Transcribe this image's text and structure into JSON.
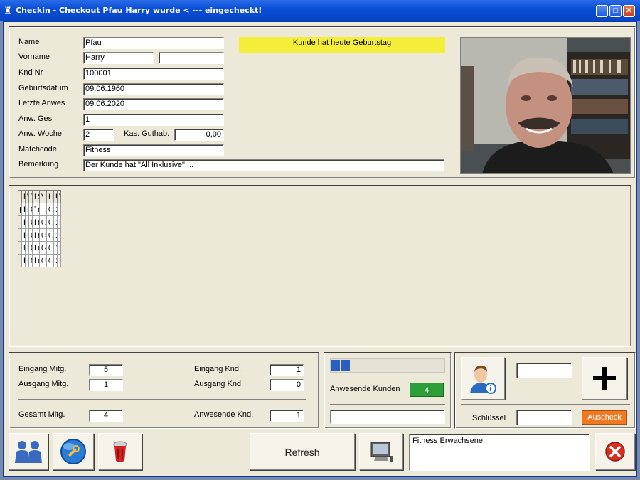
{
  "window": {
    "title": "Checkin - Checkout Pfau Harry wurde < --- eingecheckt!"
  },
  "form": {
    "labels": {
      "name": "Name",
      "vorname": "Vorname",
      "kndnr": "Knd Nr",
      "geburtsdatum": "Geburtsdatum",
      "letzte_anwes": "Letzte Anwes",
      "anw_ges": "Anw. Ges",
      "anw_woche": "Anw. Woche",
      "kas_guthab": "Kas. Guthab.",
      "matchcode": "Matchcode",
      "bemerkung": "Bemerkung"
    },
    "values": {
      "name": "Pfau",
      "vorname": "Harry",
      "vorname2": "",
      "kndnr": "100001",
      "geburtsdatum": "09.06.1960",
      "letzte_anwes": "09.06.2020",
      "anw_ges": "1",
      "anw_woche": "2",
      "kas_guthab": "0,00",
      "matchcode": "Fitness",
      "bemerkung": "Der Kunde hat \"All Inklusive\"...."
    },
    "birthday_notice": "Kunde hat heute Geburtstag"
  },
  "table": {
    "columns": [
      "Name",
      "Vorname",
      "Telefon",
      "Matchcode",
      "Status",
      "Vertr.Ende",
      "Schlüssel",
      "Punkte",
      "Kndnr",
      "Uhrzeit",
      "Vertragsteile"
    ],
    "rows": [
      [
        "Barzahler",
        "Paul",
        "08331-12915",
        "Tennis",
        "n",
        "",
        "1",
        "0",
        "100000",
        "11:24:0",
        ""
      ],
      [
        "Biechteler",
        "Paule",
        "08331",
        "Fitness",
        "m",
        "01.02.2021",
        "2",
        "0",
        "100003",
        "11:24:0",
        "Fitness Erwachsene"
      ],
      [
        "Hense",
        "Hans",
        "08331",
        "Patient",
        "m",
        "01.03.2021",
        "5",
        "0",
        "100004",
        "11:25:0",
        "Fitness Erwachsene"
      ],
      [
        "Musterfrau",
        "Paula",
        "08331",
        "Fitness",
        "m",
        "01.01.2021",
        "4",
        "0",
        "100002",
        "11:25:0",
        "Fitness Erwachsene"
      ],
      [
        "Pfau",
        "Harry",
        "08331-12915",
        "Fitness",
        "m",
        "01.01.2021",
        "55",
        "0",
        "100001",
        "11:27:0",
        "Fitness Erwachsene"
      ]
    ]
  },
  "stats": {
    "eingang_mitg_label": "Eingang Mitg.",
    "eingang_mitg": "5",
    "ausgang_mitg_label": "Ausgang Mitg.",
    "ausgang_mitg": "1",
    "gesamt_mitg_label": "Gesamt Mitg.",
    "gesamt_mitg": "4",
    "eingang_knd_label": "Eingang Knd.",
    "eingang_knd": "1",
    "ausgang_knd_label": "Ausgang Knd.",
    "ausgang_knd": "0",
    "anwesende_knd_label": "Anwesende Knd.",
    "anwesende_knd": "1"
  },
  "presence": {
    "label": "Anwesende Kunden",
    "count": "4",
    "progress_segments": 2,
    "bottom_field": ""
  },
  "key": {
    "user_field": "",
    "schluessel_label": "Schlüssel",
    "schluessel_value": "",
    "auscheck_label": "Auscheck"
  },
  "footer": {
    "refresh_label": "Refresh",
    "info_text": "Fitness Erwachsene"
  },
  "icons": {
    "members": "people-icon",
    "search": "search-globe-icon",
    "trash": "trash-icon",
    "monitor": "monitor-icon",
    "user_info": "user-info-icon",
    "add": "plus-icon",
    "close": "close-icon"
  },
  "colors": {
    "title_bar": "#0a4fd8",
    "birthday_bg": "#f4ee3a",
    "count_bg": "#2e9e3a",
    "auscheck_bg": "#f07820",
    "progress": "#2a5fc0"
  }
}
